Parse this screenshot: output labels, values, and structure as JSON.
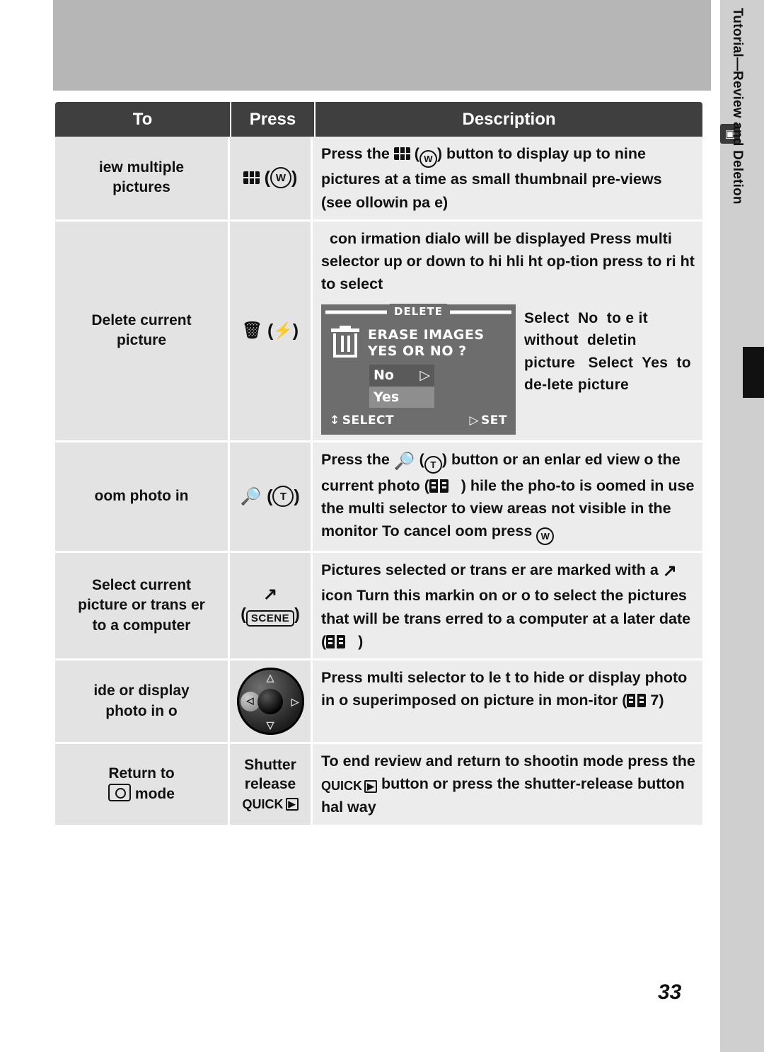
{
  "page": {
    "number": "33",
    "side_tab_label": "Tutorial—Review and Deletion",
    "side_tab_icon": "book-icon"
  },
  "table": {
    "headers": {
      "to": "To",
      "press": "Press",
      "description": "Description"
    },
    "rows": [
      {
        "to": "iew multiple\npictures",
        "press_icons": "thumbnail-icon (W)",
        "description": "Press the  (  ) button to display up to nine pictures at a time as small thumbnail pre-views (see  ollowin   pa  e)"
      },
      {
        "to": "Delete current\npicture",
        "press_icons": "trash-icon (flash-icon)",
        "description_top": "con irmation dialo   will be displayed  Press multi selector up or down to hi  hli  ht op-tion  press to ri  ht to select",
        "description_side": "Select  No  to e  it without  deletin  picture   Select  Yes  to de-lete picture",
        "lcd": {
          "title": "DELETE",
          "message_line1": "ERASE IMAGES",
          "message_line2": "YES OR NO ?",
          "option_no": "No",
          "option_yes": "Yes",
          "footer_left": "SELECT",
          "footer_right": "SET"
        }
      },
      {
        "to": "oom photo in",
        "press_icons": "magnifier-icon (T)",
        "description": "Press the  (  ) button  or an enlar  ed view o  the current photo (    )    hile the pho-to is  oomed in  use the multi selector to view areas not visible in the monitor   To cancel  oom  press"
      },
      {
        "to": "Select current\npicture  or trans er\nto a computer",
        "press_icons": "transfer-icon (SCENE)",
        "description": "Pictures selected  or trans er are marked with a   icon   Turn this markin   on or o    to select the pictures that will be trans erred to a computer at a later date (    )"
      },
      {
        "to": "ide or display\nphoto in o",
        "press_icons": "multi-selector-dial",
        "description": "Press multi selector to le  t to hide or display photo in o superimposed on picture in mon-itor (   7)"
      },
      {
        "to": "Return to\n mode",
        "press_line1": "Shutter",
        "press_line2": "release",
        "press_icons": "QUICK-play-icon",
        "description": "To end review and return to shootin   mode  press the QUICK  button or press the shutter-release button hal way"
      }
    ]
  }
}
